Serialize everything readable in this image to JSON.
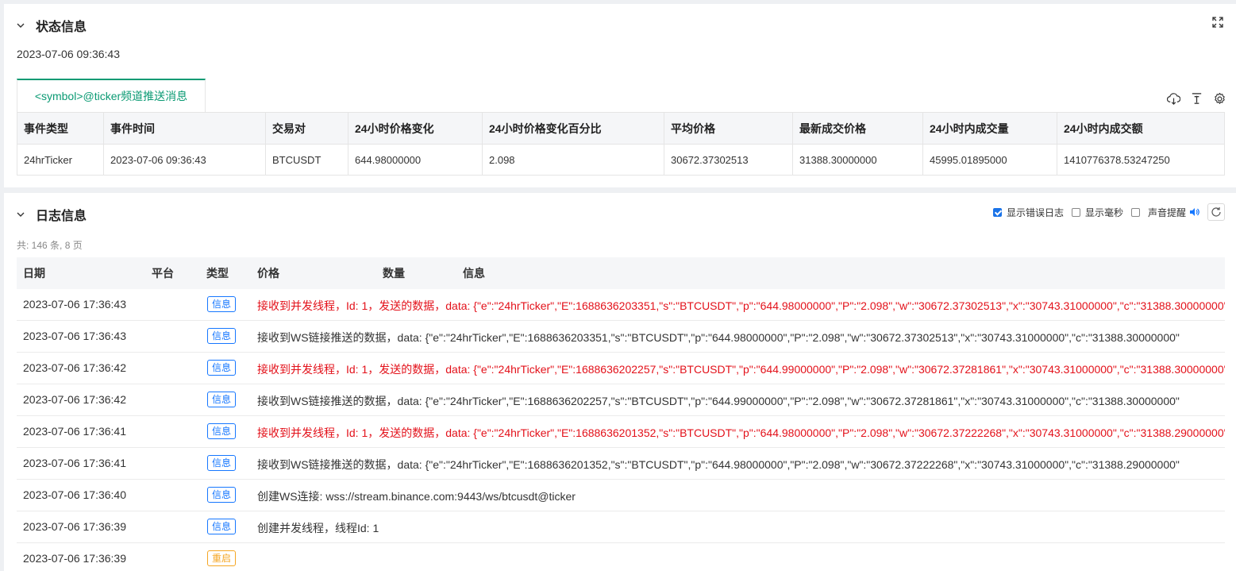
{
  "status": {
    "title": "状态信息",
    "timestamp": "2023-07-06 09:36:43",
    "tab_label": "<symbol>@ticker频道推送消息",
    "table": {
      "headers": [
        "事件类型",
        "事件时间",
        "交易对",
        "24小时价格变化",
        "24小时价格变化百分比",
        "平均价格",
        "最新成交价格",
        "24小时内成交量",
        "24小时内成交额"
      ],
      "row": [
        "24hrTicker",
        "2023-07-06 09:36:43",
        "BTCUSDT",
        "644.98000000",
        "2.098",
        "30672.37302513",
        "31388.30000000",
        "45995.01895000",
        "1410776378.53247250"
      ]
    },
    "icons": [
      "chevron-down-icon",
      "expand-icon",
      "cloud-download-icon",
      "align-top-icon",
      "gear-icon"
    ]
  },
  "log": {
    "title": "日志信息",
    "controls": {
      "show_error": "显示错误日志",
      "show_ms": "显示毫秒",
      "sound": "声音提醒"
    },
    "count_text": "共: 146 条, 8 页",
    "headers": [
      "日期",
      "平台",
      "类型",
      "价格",
      "数量",
      "信息"
    ],
    "rows": [
      {
        "date": "2023-07-06 17:36:43",
        "type": "信息",
        "msg": "接收到并发线程，Id: 1，发送的数据，data: {\"e\":\"24hrTicker\",\"E\":1688636203351,\"s\":\"BTCUSDT\",\"p\":\"644.98000000\",\"P\":\"2.098\",\"w\":\"30672.37302513\",\"x\":\"30743.31000000\",\"c\":\"31388.30000000\"",
        "red": true
      },
      {
        "date": "2023-07-06 17:36:43",
        "type": "信息",
        "msg": "接收到WS链接推送的数据，data: {\"e\":\"24hrTicker\",\"E\":1688636203351,\"s\":\"BTCUSDT\",\"p\":\"644.98000000\",\"P\":\"2.098\",\"w\":\"30672.37302513\",\"x\":\"30743.31000000\",\"c\":\"31388.30000000\"",
        "red": false
      },
      {
        "date": "2023-07-06 17:36:42",
        "type": "信息",
        "msg": "接收到并发线程，Id: 1，发送的数据，data: {\"e\":\"24hrTicker\",\"E\":1688636202257,\"s\":\"BTCUSDT\",\"p\":\"644.99000000\",\"P\":\"2.098\",\"w\":\"30672.37281861\",\"x\":\"30743.31000000\",\"c\":\"31388.30000000\"",
        "red": true
      },
      {
        "date": "2023-07-06 17:36:42",
        "type": "信息",
        "msg": "接收到WS链接推送的数据，data: {\"e\":\"24hrTicker\",\"E\":1688636202257,\"s\":\"BTCUSDT\",\"p\":\"644.99000000\",\"P\":\"2.098\",\"w\":\"30672.37281861\",\"x\":\"30743.31000000\",\"c\":\"31388.30000000\"",
        "red": false
      },
      {
        "date": "2023-07-06 17:36:41",
        "type": "信息",
        "msg": "接收到并发线程，Id: 1，发送的数据，data: {\"e\":\"24hrTicker\",\"E\":1688636201352,\"s\":\"BTCUSDT\",\"p\":\"644.98000000\",\"P\":\"2.098\",\"w\":\"30672.37222268\",\"x\":\"30743.31000000\",\"c\":\"31388.29000000\"",
        "red": true
      },
      {
        "date": "2023-07-06 17:36:41",
        "type": "信息",
        "msg": "接收到WS链接推送的数据，data: {\"e\":\"24hrTicker\",\"E\":1688636201352,\"s\":\"BTCUSDT\",\"p\":\"644.98000000\",\"P\":\"2.098\",\"w\":\"30672.37222268\",\"x\":\"30743.31000000\",\"c\":\"31388.29000000\"",
        "red": false
      },
      {
        "date": "2023-07-06 17:36:40",
        "type": "信息",
        "msg": "创建WS连接: wss://stream.binance.com:9443/ws/btcusdt@ticker",
        "red": false
      },
      {
        "date": "2023-07-06 17:36:39",
        "type": "信息",
        "msg": "创建并发线程，线程Id: 1",
        "red": false
      },
      {
        "date": "2023-07-06 17:36:39",
        "type": "重启",
        "msg": "",
        "red": false,
        "warn": true
      }
    ],
    "icons": [
      "chevron-down-icon",
      "speaker-icon",
      "refresh-icon"
    ]
  },
  "colors": {
    "accent": "#0a9a73",
    "info_badge": "#1677ff",
    "restart_badge": "#f5a623",
    "error_text": "#e3111a"
  }
}
